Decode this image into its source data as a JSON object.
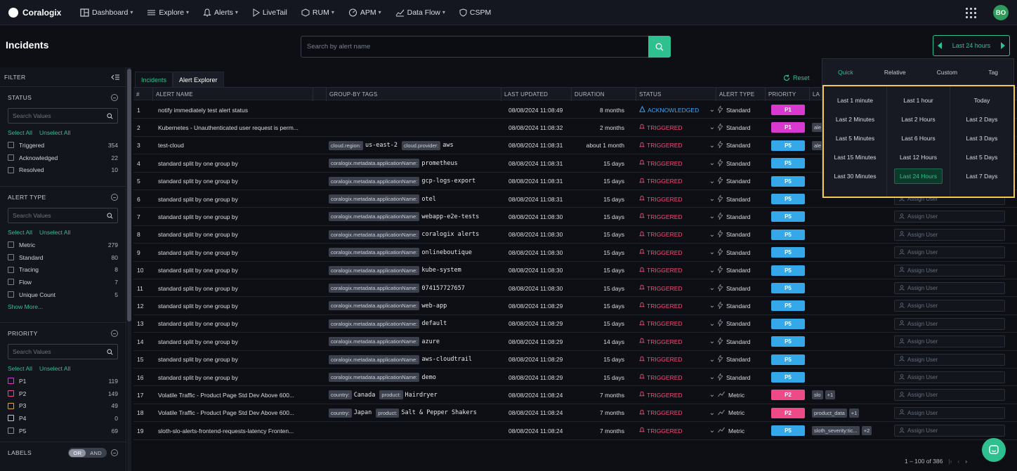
{
  "nav": {
    "brand": "Coralogix",
    "items": [
      "Dashboard",
      "Explore",
      "Alerts",
      "LiveTail",
      "RUM",
      "APM",
      "Data Flow",
      "CSPM"
    ],
    "avatar": "BO"
  },
  "page": {
    "title": "Incidents",
    "search_placeholder": "Search by alert name",
    "timerange": "Last 24 hours"
  },
  "filter": {
    "title": "FILTER",
    "select_all": "Select All",
    "unselect_all": "Unselect All",
    "search_placeholder": "Search Values",
    "status": {
      "title": "STATUS",
      "options": [
        {
          "label": "Triggered",
          "count": "354"
        },
        {
          "label": "Acknowledged",
          "count": "22"
        },
        {
          "label": "Resolved",
          "count": "10"
        }
      ]
    },
    "alert_type": {
      "title": "ALERT TYPE",
      "options": [
        {
          "label": "Metric",
          "count": "279"
        },
        {
          "label": "Standard",
          "count": "80"
        },
        {
          "label": "Tracing",
          "count": "8"
        },
        {
          "label": "Flow",
          "count": "7"
        },
        {
          "label": "Unique Count",
          "count": "5"
        }
      ],
      "show_more": "Show More..."
    },
    "priority": {
      "title": "PRIORITY",
      "options": [
        {
          "label": "P1",
          "count": "119",
          "color": "#d83ad0"
        },
        {
          "label": "P2",
          "count": "149",
          "color": "#ee4a8a"
        },
        {
          "label": "P3",
          "count": "49",
          "color": "#e8a13a"
        },
        {
          "label": "P4",
          "count": "0",
          "color": "#e8d23a"
        },
        {
          "label": "P5",
          "count": "69",
          "color": "#34a8e8"
        }
      ]
    },
    "labels": {
      "title": "LABELS",
      "or": "OR",
      "and": "AND"
    }
  },
  "tabs": [
    "Incidents",
    "Alert Explorer"
  ],
  "reset": "Reset",
  "columns": [
    "#",
    "ALERT NAME",
    "GROUP-BY TAGS",
    "LAST UPDATED",
    "DURATION",
    "STATUS",
    "ALERT TYPE",
    "PRIORITY",
    "LA"
  ],
  "assign_label": "Assign User",
  "rows": [
    {
      "n": "1",
      "name": "notify immediately test alert status",
      "tags": [],
      "updated": "08/08/2024 11:08:49",
      "duration": "8 months",
      "status": "ACKNOWLEDGED",
      "type": "Standard",
      "prio": "P1",
      "labels": [],
      "assign": false
    },
    {
      "n": "2",
      "name": "Kubernetes - Unauthenticated user request is perm...",
      "tags": [],
      "updated": "08/08/2024 11:08:32",
      "duration": "2 months",
      "status": "TRIGGERED",
      "type": "Standard",
      "prio": "P1",
      "labels": [
        "ale"
      ],
      "assign": false
    },
    {
      "n": "3",
      "name": "test-cloud",
      "tags": [
        [
          "cloud.region:",
          "us-east-2"
        ],
        [
          "cloud.provider:",
          "aws"
        ]
      ],
      "updated": "08/08/2024 11:08:31",
      "duration": "about 1 month",
      "status": "TRIGGERED",
      "type": "Standard",
      "prio": "P5",
      "labels": [
        "ale"
      ],
      "assign": false
    },
    {
      "n": "4",
      "name": "standard split by one group by",
      "tags": [
        [
          "coralogix.metadata.applicationName:",
          "prometheus"
        ]
      ],
      "updated": "08/08/2024 11:08:31",
      "duration": "15 days",
      "status": "TRIGGERED",
      "type": "Standard",
      "prio": "P5",
      "labels": [],
      "assign": false
    },
    {
      "n": "5",
      "name": "standard split by one group by",
      "tags": [
        [
          "coralogix.metadata.applicationName:",
          "gcp-logs-export"
        ]
      ],
      "updated": "08/08/2024 11:08:31",
      "duration": "15 days",
      "status": "TRIGGERED",
      "type": "Standard",
      "prio": "P5",
      "labels": [],
      "assign": false
    },
    {
      "n": "6",
      "name": "standard split by one group by",
      "tags": [
        [
          "coralogix.metadata.applicationName:",
          "otel"
        ]
      ],
      "updated": "08/08/2024 11:08:31",
      "duration": "15 days",
      "status": "TRIGGERED",
      "type": "Standard",
      "prio": "P5",
      "labels": [],
      "assign": true
    },
    {
      "n": "7",
      "name": "standard split by one group by",
      "tags": [
        [
          "coralogix.metadata.applicationName:",
          "webapp-e2e-tests"
        ]
      ],
      "updated": "08/08/2024 11:08:30",
      "duration": "15 days",
      "status": "TRIGGERED",
      "type": "Standard",
      "prio": "P5",
      "labels": [],
      "assign": true
    },
    {
      "n": "8",
      "name": "standard split by one group by",
      "tags": [
        [
          "coralogix.metadata.applicationName:",
          "coralogix alerts"
        ]
      ],
      "updated": "08/08/2024 11:08:30",
      "duration": "15 days",
      "status": "TRIGGERED",
      "type": "Standard",
      "prio": "P5",
      "labels": [],
      "assign": true
    },
    {
      "n": "9",
      "name": "standard split by one group by",
      "tags": [
        [
          "coralogix.metadata.applicationName:",
          "onlineboutique"
        ]
      ],
      "updated": "08/08/2024 11:08:30",
      "duration": "15 days",
      "status": "TRIGGERED",
      "type": "Standard",
      "prio": "P5",
      "labels": [],
      "assign": true
    },
    {
      "n": "10",
      "name": "standard split by one group by",
      "tags": [
        [
          "coralogix.metadata.applicationName:",
          "kube-system"
        ]
      ],
      "updated": "08/08/2024 11:08:30",
      "duration": "15 days",
      "status": "TRIGGERED",
      "type": "Standard",
      "prio": "P5",
      "labels": [],
      "assign": true
    },
    {
      "n": "11",
      "name": "standard split by one group by",
      "tags": [
        [
          "coralogix.metadata.applicationName:",
          "074157727657"
        ]
      ],
      "updated": "08/08/2024 11:08:30",
      "duration": "15 days",
      "status": "TRIGGERED",
      "type": "Standard",
      "prio": "P5",
      "labels": [],
      "assign": true
    },
    {
      "n": "12",
      "name": "standard split by one group by",
      "tags": [
        [
          "coralogix.metadata.applicationName:",
          "web-app"
        ]
      ],
      "updated": "08/08/2024 11:08:29",
      "duration": "15 days",
      "status": "TRIGGERED",
      "type": "Standard",
      "prio": "P5",
      "labels": [],
      "assign": true
    },
    {
      "n": "13",
      "name": "standard split by one group by",
      "tags": [
        [
          "coralogix.metadata.applicationName:",
          "default"
        ]
      ],
      "updated": "08/08/2024 11:08:29",
      "duration": "15 days",
      "status": "TRIGGERED",
      "type": "Standard",
      "prio": "P5",
      "labels": [],
      "assign": true
    },
    {
      "n": "14",
      "name": "standard split by one group by",
      "tags": [
        [
          "coralogix.metadata.applicationName:",
          "azure"
        ]
      ],
      "updated": "08/08/2024 11:08:29",
      "duration": "14 days",
      "status": "TRIGGERED",
      "type": "Standard",
      "prio": "P5",
      "labels": [],
      "assign": true
    },
    {
      "n": "15",
      "name": "standard split by one group by",
      "tags": [
        [
          "coralogix.metadata.applicationName:",
          "aws-cloudtrail"
        ]
      ],
      "updated": "08/08/2024 11:08:29",
      "duration": "15 days",
      "status": "TRIGGERED",
      "type": "Standard",
      "prio": "P5",
      "labels": [],
      "assign": true
    },
    {
      "n": "16",
      "name": "standard split by one group by",
      "tags": [
        [
          "coralogix.metadata.applicationName:",
          "demo"
        ]
      ],
      "updated": "08/08/2024 11:08:29",
      "duration": "15 days",
      "status": "TRIGGERED",
      "type": "Standard",
      "prio": "P5",
      "labels": [],
      "assign": true
    },
    {
      "n": "17",
      "name": "Volatile Traffic - Product Page Std Dev Above 600...",
      "tags": [
        [
          "country:",
          "Canada"
        ],
        [
          "product:",
          "Hairdryer"
        ]
      ],
      "updated": "08/08/2024 11:08:24",
      "duration": "7 months",
      "status": "TRIGGERED",
      "type": "Metric",
      "prio": "P2",
      "labels": [
        "slo",
        "+1"
      ],
      "assign": true
    },
    {
      "n": "18",
      "name": "Volatile Traffic - Product Page Std Dev Above 600...",
      "tags": [
        [
          "country:",
          "Japan"
        ],
        [
          "product:",
          "Salt & Pepper Shakers"
        ]
      ],
      "updated": "08/08/2024 11:08:24",
      "duration": "7 months",
      "status": "TRIGGERED",
      "type": "Metric",
      "prio": "P2",
      "labels": [
        "product_data",
        "+1"
      ],
      "assign": true
    },
    {
      "n": "19",
      "name": "sloth-slo-alerts-frontend-requests-latency Fronten...",
      "tags": [],
      "updated": "08/08/2024 11:08:24",
      "duration": "7 months",
      "status": "TRIGGERED",
      "type": "Metric",
      "prio": "P5",
      "labels": [
        "sloth_severity:tic...",
        "+2"
      ],
      "assign": true
    }
  ],
  "pagination": "1 – 100 of 386",
  "time_dropdown": {
    "tabs": [
      "Quick",
      "Relative",
      "Custom",
      "Tag"
    ],
    "col1": [
      "Last 1 minute",
      "Last 2 Minutes",
      "Last 5 Minutes",
      "Last 15 Minutes",
      "Last 30 Minutes"
    ],
    "col2": [
      "Last 1 hour",
      "Last 2 Hours",
      "Last 6 Hours",
      "Last 12 Hours",
      "Last 24 Hours"
    ],
    "col3": [
      "Today",
      "Last 2 Days",
      "Last 3 Days",
      "Last 5 Days",
      "Last 7 Days"
    ],
    "selected": "Last 24 Hours"
  },
  "colors": {
    "accent": "#2fc090",
    "triggered": "#f0507a",
    "acknowledged": "#3fa7f5",
    "highlight": "#f2c94c"
  }
}
